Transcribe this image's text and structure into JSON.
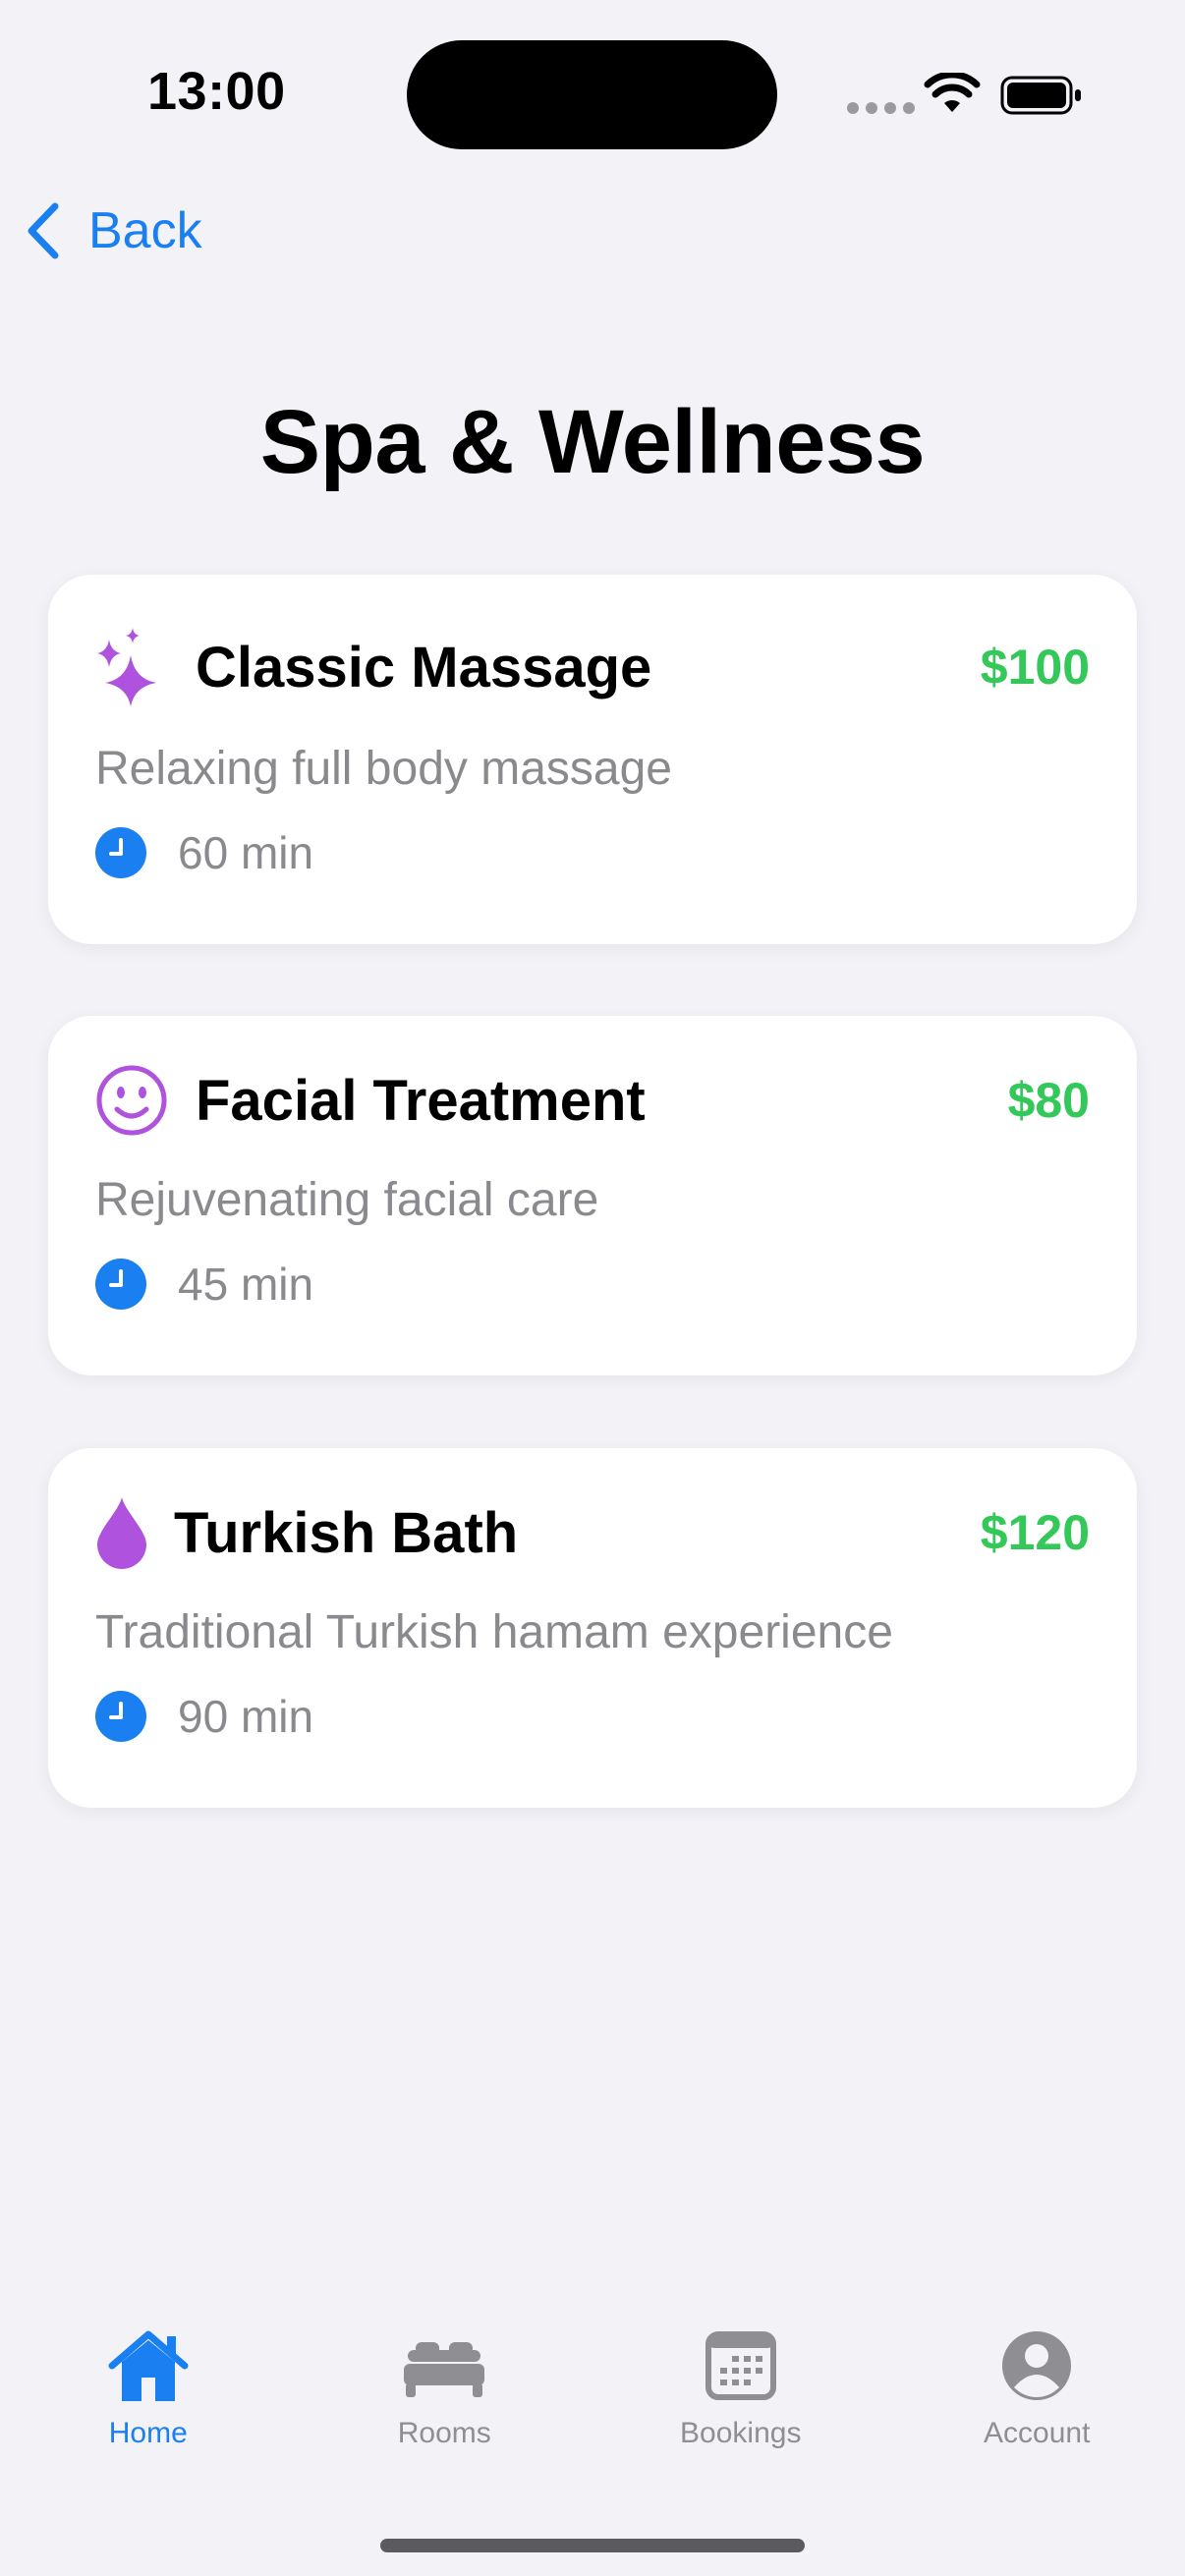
{
  "status_bar": {
    "time": "13:00"
  },
  "nav": {
    "back_label": "Back"
  },
  "page": {
    "title": "Spa & Wellness"
  },
  "services": [
    {
      "icon": "sparkles-icon",
      "title": "Classic Massage",
      "price": "$100",
      "description": "Relaxing full body massage",
      "duration": "60 min"
    },
    {
      "icon": "smiley-face-icon",
      "title": "Facial Treatment",
      "price": "$80",
      "description": "Rejuvenating facial care",
      "duration": "45 min"
    },
    {
      "icon": "drop-icon",
      "title": "Turkish Bath",
      "price": "$120",
      "description": "Traditional Turkish hamam experience",
      "duration": "90 min"
    }
  ],
  "tab_bar": {
    "tabs": [
      {
        "label": "Home",
        "icon": "house-icon",
        "active": true
      },
      {
        "label": "Rooms",
        "icon": "bed-icon",
        "active": false
      },
      {
        "label": "Bookings",
        "icon": "calendar-icon",
        "active": false
      },
      {
        "label": "Account",
        "icon": "person-circle-icon",
        "active": false
      }
    ]
  },
  "colors": {
    "accent": "#1a7ff0",
    "price": "#34c759",
    "service_icon": "#af52de",
    "secondary_text": "#8a8a8e",
    "background": "#f2f2f7"
  }
}
